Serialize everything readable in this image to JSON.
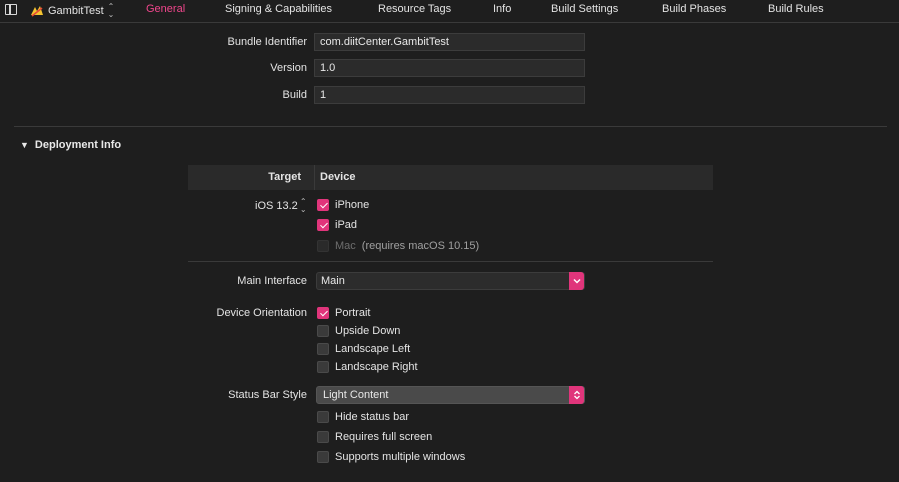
{
  "toolbar": {
    "target_name": "GambitTest",
    "tabs": [
      "General",
      "Signing & Capabilities",
      "Resource Tags",
      "Info",
      "Build Settings",
      "Build Phases",
      "Build Rules"
    ],
    "active_tab": "General",
    "accent_color": "#f0468c"
  },
  "identity": {
    "bundle_identifier_label": "Bundle Identifier",
    "bundle_identifier_value": "com.diitCenter.GambitTest",
    "version_label": "Version",
    "version_value": "1.0",
    "build_label": "Build",
    "build_value": "1"
  },
  "deployment": {
    "section_title": "Deployment Info",
    "table_header_target": "Target",
    "table_header_device": "Device",
    "ios_version": "iOS 13.2",
    "devices": [
      {
        "label": "iPhone",
        "checked": true,
        "enabled": true
      },
      {
        "label": "iPad",
        "checked": true,
        "enabled": true
      },
      {
        "label": "Mac",
        "note": "(requires macOS 10.15)",
        "checked": false,
        "enabled": false
      }
    ],
    "main_interface_label": "Main Interface",
    "main_interface_value": "Main",
    "device_orientation_label": "Device Orientation",
    "orientations": [
      {
        "label": "Portrait",
        "checked": true
      },
      {
        "label": "Upside Down",
        "checked": false
      },
      {
        "label": "Landscape Left",
        "checked": false
      },
      {
        "label": "Landscape Right",
        "checked": false
      }
    ],
    "status_bar_style_label": "Status Bar Style",
    "status_bar_style_value": "Light Content",
    "status_options": [
      {
        "label": "Hide status bar",
        "checked": false
      },
      {
        "label": "Requires full screen",
        "checked": false
      },
      {
        "label": "Supports multiple windows",
        "checked": false
      }
    ],
    "checkbox_on_color": "#e0357b"
  }
}
